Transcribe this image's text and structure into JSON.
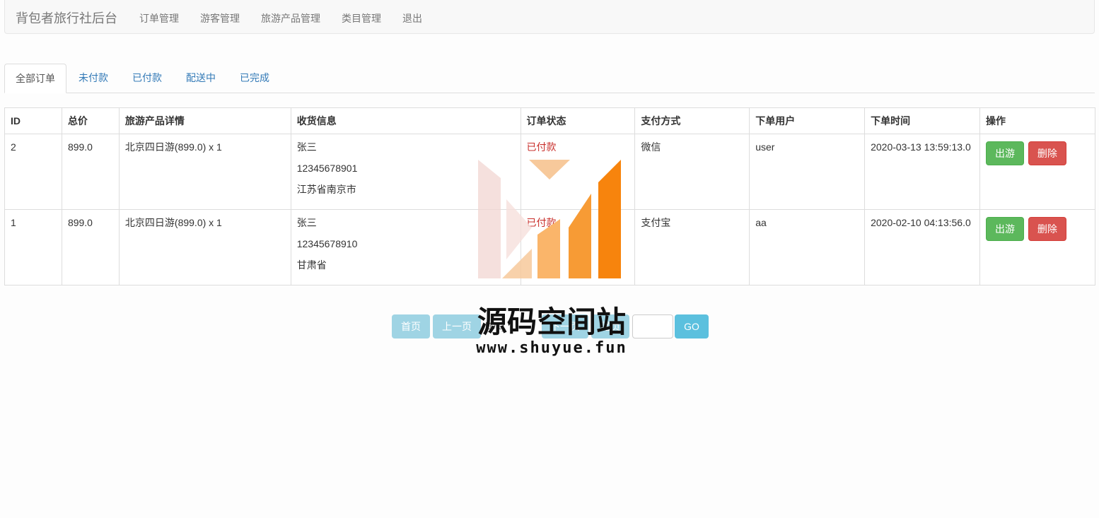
{
  "navbar": {
    "brand": "背包者旅行社后台",
    "links": [
      "订单管理",
      "游客管理",
      "旅游产品管理",
      "类目管理",
      "退出"
    ]
  },
  "tabs": [
    "全部订单",
    "未付款",
    "已付款",
    "配送中",
    "已完成"
  ],
  "table": {
    "headers": [
      "ID",
      "总价",
      "旅游产品详情",
      "收货信息",
      "订单状态",
      "支付方式",
      "下单用户",
      "下单时间",
      "操作"
    ],
    "rows": [
      {
        "id": "2",
        "total": "899.0",
        "product": "北京四日游(899.0) x 1",
        "receiver": {
          "name": "张三",
          "phone": "12345678901",
          "address": "江苏省南京市"
        },
        "status": "已付款",
        "payment": "微信",
        "user": "user",
        "time": "2020-03-13 13:59:13.0"
      },
      {
        "id": "1",
        "total": "899.0",
        "product": "北京四日游(899.0) x 1",
        "receiver": {
          "name": "张三",
          "phone": "12345678910",
          "address": "甘肃省"
        },
        "status": "已付款",
        "payment": "支付宝",
        "user": "aa",
        "time": "2020-02-10 04:13:56.0"
      }
    ],
    "actions": {
      "travel": "出游",
      "delete": "删除"
    }
  },
  "pagination": {
    "first": "首页",
    "prev": "上一页",
    "page_info": "[1/1]",
    "next": "下一页",
    "last": "尾页",
    "input_value": "",
    "go": "GO"
  },
  "watermark": {
    "title": "源码空间站",
    "url": "www.shuyue.fun"
  },
  "colors": {
    "link": "#337ab7",
    "status_paid": "#c9302c",
    "btn_success": "#5cb85c",
    "btn_danger": "#d9534f",
    "pager_button": "#9fd4e4",
    "go_button": "#5bc0de"
  }
}
